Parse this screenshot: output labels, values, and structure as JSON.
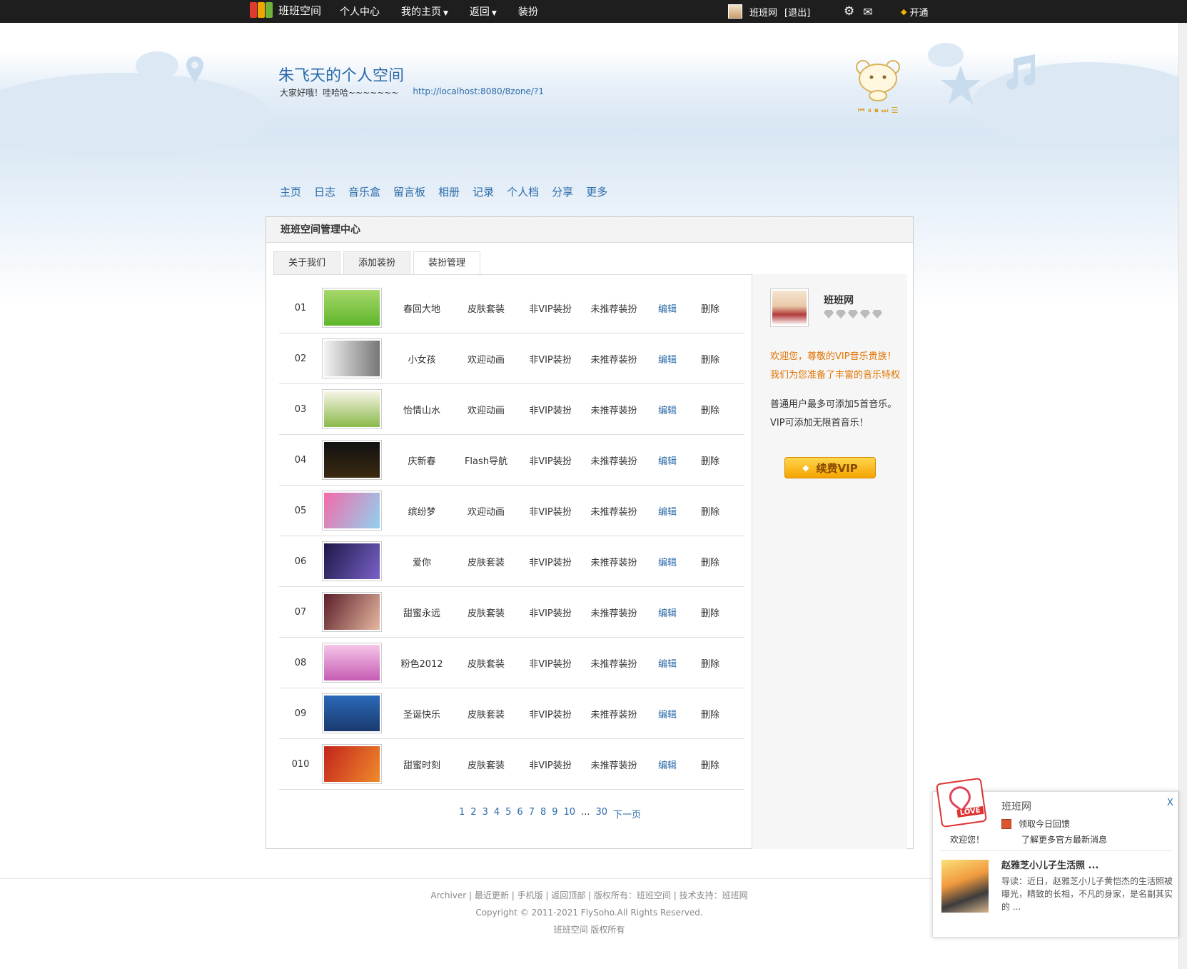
{
  "topbar": {
    "site_name": "班班空间",
    "nav": [
      {
        "label": "个人中心",
        "caret": false
      },
      {
        "label": "我的主页",
        "caret": true
      },
      {
        "label": "返回",
        "caret": true
      },
      {
        "label": "装扮",
        "caret": false
      }
    ],
    "user_name": "班班网",
    "logout": "[退出]",
    "vip_label": "开通"
  },
  "header": {
    "title": "朱飞天的个人空间",
    "subtitle": "大家好哦！哇哈哈~~~~~~~",
    "url": "http://localhost:8080/8zone/?1"
  },
  "mainnav": [
    "主页",
    "日志",
    "音乐盒",
    "留言板",
    "相册",
    "记录",
    "个人档",
    "分享",
    "更多"
  ],
  "panel": {
    "title": "班班空间管理中心",
    "tabs": [
      "关于我们",
      "添加装扮",
      "装扮管理"
    ],
    "active_tab": 2
  },
  "rows": [
    {
      "no": "01",
      "name": "春回大地",
      "type": "皮肤套装",
      "vip": "非VIP装扮",
      "rec": "未推荐装扮",
      "edit": "编辑",
      "del": "删除",
      "thumb": "linear-gradient(180deg,#a6d86a,#5fb52b)"
    },
    {
      "no": "02",
      "name": "小女孩",
      "type": "欢迎动画",
      "vip": "非VIP装扮",
      "rec": "未推荐装扮",
      "edit": "编辑",
      "del": "删除",
      "thumb": "linear-gradient(90deg,#f3f3f3,#777)"
    },
    {
      "no": "03",
      "name": "怡情山水",
      "type": "欢迎动画",
      "vip": "非VIP装扮",
      "rec": "未推荐装扮",
      "edit": "编辑",
      "del": "删除",
      "thumb": "linear-gradient(180deg,#f6f4e6,#8cb94a)"
    },
    {
      "no": "04",
      "name": "庆新春",
      "type": "Flash导航",
      "vip": "非VIP装扮",
      "rec": "未推荐装扮",
      "edit": "编辑",
      "del": "删除",
      "thumb": "linear-gradient(180deg,#111,#3a2a10)"
    },
    {
      "no": "05",
      "name": "缤纷梦",
      "type": "欢迎动画",
      "vip": "非VIP装扮",
      "rec": "未推荐装扮",
      "edit": "编辑",
      "del": "删除",
      "thumb": "linear-gradient(120deg,#f46aa8,#8fd2f0)"
    },
    {
      "no": "06",
      "name": "爱你",
      "type": "皮肤套装",
      "vip": "非VIP装扮",
      "rec": "未推荐装扮",
      "edit": "编辑",
      "del": "删除",
      "thumb": "linear-gradient(120deg,#1d1747,#7a62c8)"
    },
    {
      "no": "07",
      "name": "甜蜜永远",
      "type": "皮肤套装",
      "vip": "非VIP装扮",
      "rec": "未推荐装扮",
      "edit": "编辑",
      "del": "删除",
      "thumb": "linear-gradient(120deg,#5b1f2a,#e6b7a0)"
    },
    {
      "no": "08",
      "name": "粉色2012",
      "type": "皮肤套装",
      "vip": "非VIP装扮",
      "rec": "未推荐装扮",
      "edit": "编辑",
      "del": "删除",
      "thumb": "linear-gradient(180deg,#f6c6e8,#c65cb3)"
    },
    {
      "no": "09",
      "name": "圣诞快乐",
      "type": "皮肤套装",
      "vip": "非VIP装扮",
      "rec": "未推荐装扮",
      "edit": "编辑",
      "del": "删除",
      "thumb": "linear-gradient(180deg,#2a69b8,#1a3a6e)"
    },
    {
      "no": "010",
      "name": "甜蜜时刻",
      "type": "皮肤套装",
      "vip": "非VIP装扮",
      "rec": "未推荐装扮",
      "edit": "编辑",
      "del": "删除",
      "thumb": "linear-gradient(120deg,#c2241c,#f08a2c)"
    }
  ],
  "pager": {
    "pages": [
      "1",
      "2",
      "3",
      "4",
      "5",
      "6",
      "7",
      "8",
      "9",
      "10"
    ],
    "ellipsis": "...",
    "last": "30",
    "next": "下一页"
  },
  "sidebar": {
    "name": "班班网",
    "welcome1": "欢迎您，尊敬的VIP音乐贵族！",
    "welcome2": "我们为您准备了丰富的音乐特权",
    "info1": "普通用户最多可添加5首音乐。",
    "info2": "VIP可添加无限首音乐！",
    "button": "续费VIP"
  },
  "footer": {
    "links": "Archiver | 最近更新 | 手机版 | 返回顶部 | 版权所有：班班空间 | 技术支持：班班网",
    "copyright": "Copyright © 2011-2021 FlySoho.All Rights Reserved.",
    "owner": "班班空间 版权所有"
  },
  "popup": {
    "badge": "LOVE",
    "title": "班班网",
    "close": "X",
    "gift": "领取今日回馈",
    "welcome": "欢迎您！",
    "more": "了解更多官方最新消息",
    "news_title": "赵雅芝小儿子生活照 ...",
    "news_desc": "导读：近日，赵雅芝小儿子黄恺杰的生活照被曝光，精致的长相，不凡的身家，是名副其实的 ..."
  }
}
